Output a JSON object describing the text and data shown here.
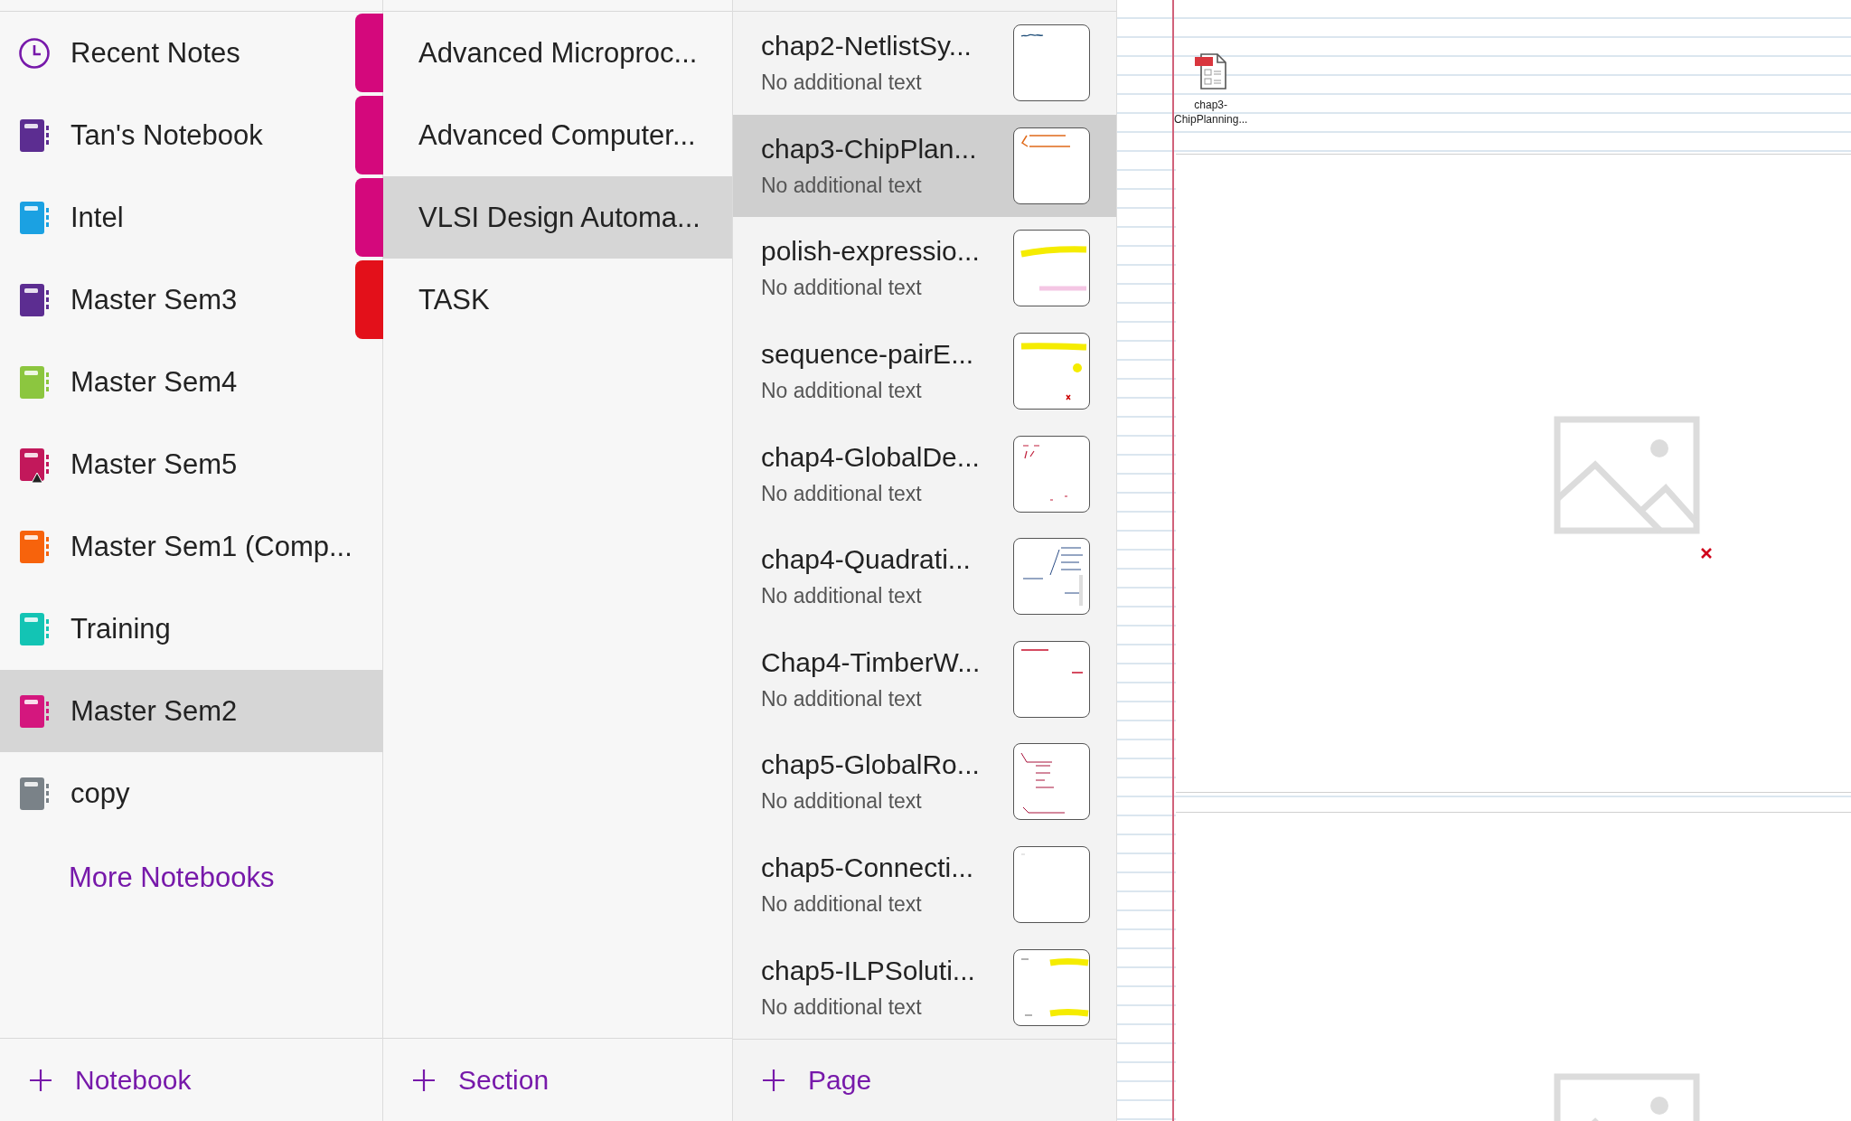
{
  "notebooks": [
    {
      "label": "Recent Notes",
      "kind": "recent",
      "selected": false
    },
    {
      "label": "Tan's Notebook",
      "kind": "notebook",
      "color": "#5c2d91",
      "selected": false,
      "warning": false
    },
    {
      "label": "Intel",
      "kind": "notebook",
      "color": "#1ba1e2",
      "selected": false,
      "warning": false
    },
    {
      "label": "Master Sem3",
      "kind": "notebook",
      "color": "#5c2d91",
      "selected": false,
      "warning": false
    },
    {
      "label": "Master Sem4",
      "kind": "notebook",
      "color": "#8cc63f",
      "selected": false,
      "warning": false
    },
    {
      "label": "Master Sem5",
      "kind": "notebook",
      "color": "#c2185b",
      "selected": false,
      "warning": true
    },
    {
      "label": "Master Sem1 (Comp...",
      "kind": "notebook",
      "color": "#f7630c",
      "selected": false,
      "warning": false
    },
    {
      "label": "Training",
      "kind": "notebook",
      "color": "#13c4b4",
      "selected": false,
      "warning": false
    },
    {
      "label": "Master Sem2",
      "kind": "notebook",
      "color": "#d4177e",
      "selected": true,
      "warning": false
    },
    {
      "label": "copy",
      "kind": "notebook",
      "color": "#7a8288",
      "selected": false,
      "warning": false
    }
  ],
  "more_notebooks": "More Notebooks",
  "sections": [
    {
      "label": "Advanced Microproc...",
      "color": "#d4087c",
      "selected": false
    },
    {
      "label": "Advanced Computer...",
      "color": "#d4087c",
      "selected": false
    },
    {
      "label": "VLSI Design Automa...",
      "color": "#d4087c",
      "selected": true
    },
    {
      "label": "TASK",
      "color": "#e3101a",
      "selected": false
    }
  ],
  "pages": [
    {
      "title": "chap2-NetlistSy...",
      "subtitle": "No additional text",
      "selected": false
    },
    {
      "title": "chap3-ChipPlan...",
      "subtitle": "No additional text",
      "selected": true
    },
    {
      "title": "polish-expressio...",
      "subtitle": "No additional text",
      "selected": false
    },
    {
      "title": "sequence-pairE...",
      "subtitle": "No additional text",
      "selected": false
    },
    {
      "title": "chap4-GlobalDe...",
      "subtitle": "No additional text",
      "selected": false
    },
    {
      "title": "chap4-Quadrati...",
      "subtitle": "No additional text",
      "selected": false
    },
    {
      "title": "Chap4-TimberW...",
      "subtitle": "No additional text",
      "selected": false
    },
    {
      "title": "chap5-GlobalRo...",
      "subtitle": "No additional text",
      "selected": false
    },
    {
      "title": "chap5-Connecti...",
      "subtitle": "No additional text",
      "selected": false
    },
    {
      "title": "chap5-ILPSoluti...",
      "subtitle": "No additional text",
      "selected": false
    }
  ],
  "footer": {
    "notebook_button": "Notebook",
    "section_button": "Section",
    "page_button": "Page"
  },
  "canvas": {
    "attachment": {
      "lines": [
        "chap3-",
        "ChipPlanning..."
      ]
    },
    "images": [
      {
        "error_mark": true
      },
      {
        "error_mark": false
      }
    ]
  }
}
